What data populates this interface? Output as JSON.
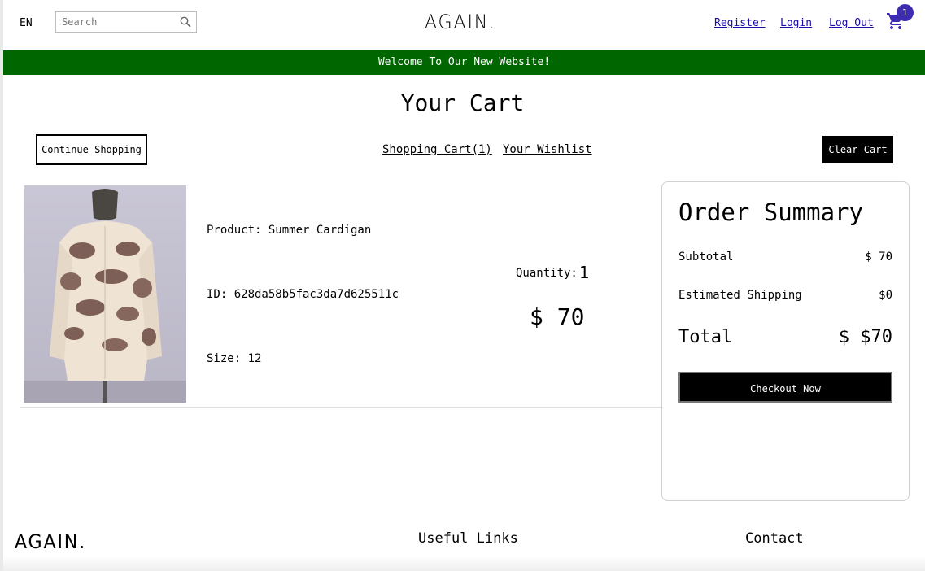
{
  "navbar": {
    "language": "EN",
    "search_placeholder": "Search",
    "logo": "AGAIN.",
    "links": [
      "Register",
      "Login",
      "Log Out"
    ],
    "cart_count": "1"
  },
  "announcement": "Welcome To Our New Website!",
  "cart": {
    "title": "Your Cart",
    "continue_label": "Continue Shopping",
    "tabs": [
      "Shopping Cart(1)",
      "Your Wishlist"
    ],
    "clear_label": "Clear Cart"
  },
  "product": {
    "name_line": "Product: Summer Cardigan",
    "id_line": "ID: 628da58b5fac3da7d625511c",
    "size_line": "Size: 12",
    "quantity_label": "Quantity:",
    "quantity": "1",
    "price": "$ 70"
  },
  "summary": {
    "title": "Order Summary",
    "subtotal_label": "Subtotal",
    "subtotal_value": "$ 70",
    "shipping_label": "Estimated Shipping",
    "shipping_value": "$0",
    "total_label": "Total",
    "total_value": "$ $70",
    "checkout_label": "Checkout Now"
  },
  "footer": {
    "logo": "AGAIN.",
    "headings": [
      "Useful Links",
      "Contact"
    ]
  },
  "colors": {
    "announcement_bg": "#006600",
    "badge": "#3d2bb0",
    "cart_icon": "#3d2bb0",
    "link": "#1a0dab"
  }
}
